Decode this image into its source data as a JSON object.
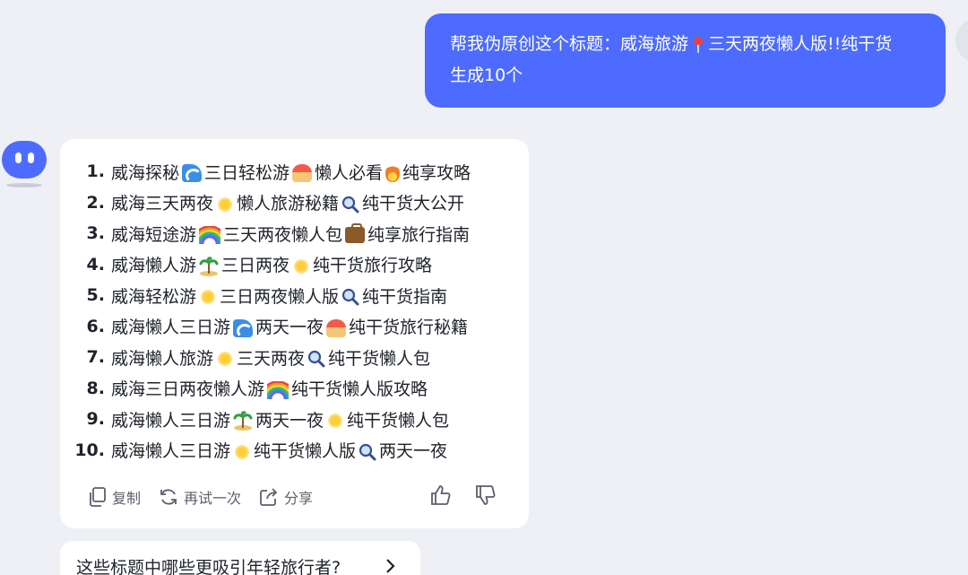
{
  "user_message": {
    "line1": "帮我伪原创这个标题：威海旅游",
    "line1_b": "三天两夜懒人版!!纯干货",
    "line2": "生成10个"
  },
  "results": [
    {
      "num": "1.",
      "parts": [
        "威海探秘",
        "wave",
        "三日轻松游",
        "beach",
        "懒人必看",
        "fire",
        "纯享攻略"
      ]
    },
    {
      "num": "2.",
      "parts": [
        "威海三天两夜",
        "sun",
        "懒人旅游秘籍",
        "lens",
        "纯干货大公开"
      ]
    },
    {
      "num": "3.",
      "parts": [
        "威海短途游",
        "rainbow",
        "三天两夜懒人包",
        "brief",
        "纯享旅行指南"
      ]
    },
    {
      "num": "4.",
      "parts": [
        "威海懒人游",
        "palm",
        "三日两夜",
        "sun",
        "纯干货旅行攻略"
      ]
    },
    {
      "num": "5.",
      "parts": [
        "威海轻松游",
        "sun",
        "三日两夜懒人版",
        "lens",
        "纯干货指南"
      ]
    },
    {
      "num": "6.",
      "parts": [
        "威海懒人三日游",
        "wave",
        "两天一夜",
        "beach",
        "纯干货旅行秘籍"
      ]
    },
    {
      "num": "7.",
      "parts": [
        "威海懒人旅游",
        "sun",
        "三天两夜",
        "lens",
        "纯干货懒人包"
      ]
    },
    {
      "num": "8.",
      "parts": [
        "威海三日两夜懒人游",
        "rainbow",
        "纯干货懒人版攻略"
      ]
    },
    {
      "num": "9.",
      "parts": [
        "威海懒人三日游",
        "palm",
        "两天一夜",
        "sun",
        "纯干货懒人包"
      ]
    },
    {
      "num": "10.",
      "parts": [
        "威海懒人三日游",
        "sun",
        "纯干货懒人版",
        "lens",
        "两天一夜"
      ]
    }
  ],
  "actions": {
    "copy": "复制",
    "retry": "再试一次",
    "share": "分享"
  },
  "suggestion": {
    "text": "这些标题中哪些更吸引年轻旅行者?"
  },
  "colors": {
    "accent": "#4d6bfe",
    "background": "#eef0f6",
    "card": "#ffffff"
  }
}
